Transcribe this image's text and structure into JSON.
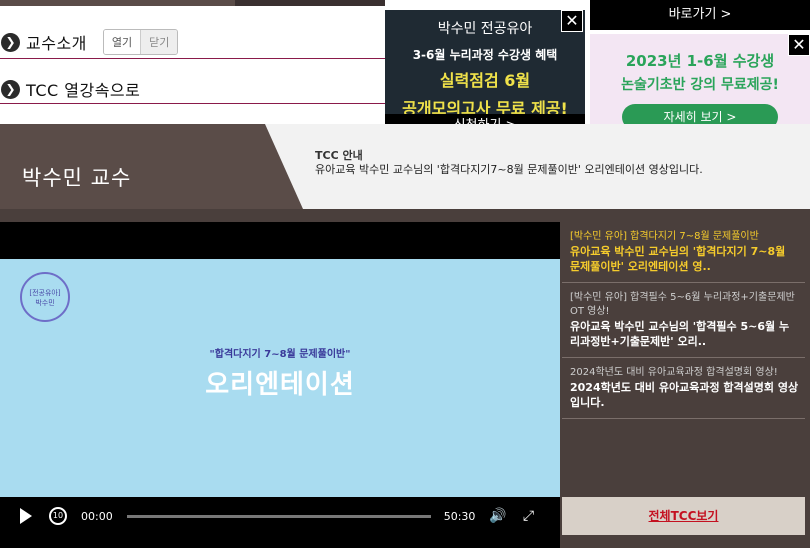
{
  "menu": {
    "intro_label": "교수소개",
    "toggle_open": "열기",
    "toggle_close": "닫기",
    "tcc_label": "TCC 열강속으로"
  },
  "ad1": {
    "title": "박수민 전공유아",
    "subtitle": "3-6월 누리과정 수강생 혜택",
    "line1": "실력점검 6월",
    "line2": "공개모의고사 무료 제공!",
    "cta": "신청하기 >",
    "close": "✕"
  },
  "ad2": {
    "top_link": "바로가기 >",
    "line1": "2023년 1-6월 수강생",
    "line2": "논술기초반 강의 무료제공!",
    "button": "자세히 보기 >",
    "close": "✕"
  },
  "header": {
    "professor": "박수민 교수",
    "tcc_title": "TCC 안내",
    "tcc_desc": "유아교육 박수민 교수님의 '합격다지기7~8월 문제풀이반' 오리엔테이션 영상입니다."
  },
  "video": {
    "badge_line1": "[전공유아]",
    "badge_line2": "박수민",
    "quote": "\"합격다지기 7~8월 문제풀이반\"",
    "title": "오리엔테이션",
    "current_time": "00:00",
    "duration": "50:30",
    "progress": 0,
    "rewind_label": "10"
  },
  "playlist": [
    {
      "sub": "[박수민 유아] 합격다지기 7~8월 문제풀이반",
      "main": "유아교육 박수민 교수님의 '합격다지기 7~8월 문제풀이반' 오리엔테이션 영..",
      "active": true
    },
    {
      "sub": "[박수민 유아] 합격필수 5~6월 누리과정+기출문제반 OT 영상!",
      "main": "유아교육 박수민 교수님의 '합격필수 5~6월 누리과정반+기출문제반' 오리..",
      "active": false
    },
    {
      "sub": "2024학년도 대비 유아교육과정 합격설명회 영상!",
      "main": "2024학년도 대비 유아교육과정 합격설명회 영상입니다.",
      "active": false
    }
  ],
  "all_tcc_label": "전체TCC보기",
  "colors": {
    "brand_brown": "#5a4c48",
    "accent_rule": "#8a1a4a",
    "active_item": "#f6cc2c",
    "link_red": "#c41020"
  }
}
